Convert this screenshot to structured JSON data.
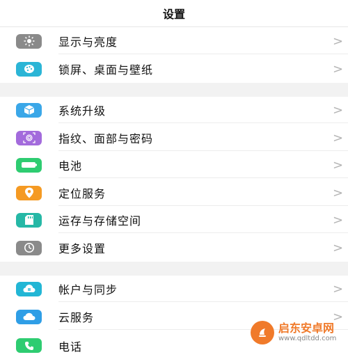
{
  "header": {
    "title": "设置"
  },
  "colors": {
    "display": "#8a8a8a",
    "theme": "#2bb5d6",
    "update": "#3aa7e8",
    "fingerprint": "#a36bdc",
    "battery": "#2ecc71",
    "location": "#f59a23",
    "storage": "#26b8a6",
    "more": "#8a8a8a",
    "account": "#22b6d5",
    "cloud": "#2f9ee6",
    "phone": "#2ecc71"
  },
  "rows": [
    {
      "label": "显示与亮度",
      "icon": "brightness-icon"
    },
    {
      "label": "锁屏、桌面与壁纸",
      "icon": "palette-icon"
    },
    {
      "label": "系统升级",
      "icon": "update-box-icon"
    },
    {
      "label": "指纹、面部与密码",
      "icon": "fingerprint-icon"
    },
    {
      "label": "电池",
      "icon": "battery-icon"
    },
    {
      "label": "定位服务",
      "icon": "location-pin-icon"
    },
    {
      "label": "运存与存储空间",
      "icon": "sd-card-icon"
    },
    {
      "label": "更多设置",
      "icon": "gear-icon"
    },
    {
      "label": "帐户与同步",
      "icon": "account-sync-icon"
    },
    {
      "label": "云服务",
      "icon": "cloud-icon"
    },
    {
      "label": "电话",
      "icon": "phone-icon"
    }
  ],
  "chevron": ">",
  "watermark": {
    "title": "启东安卓网",
    "url": "www.qdltdd.com"
  }
}
